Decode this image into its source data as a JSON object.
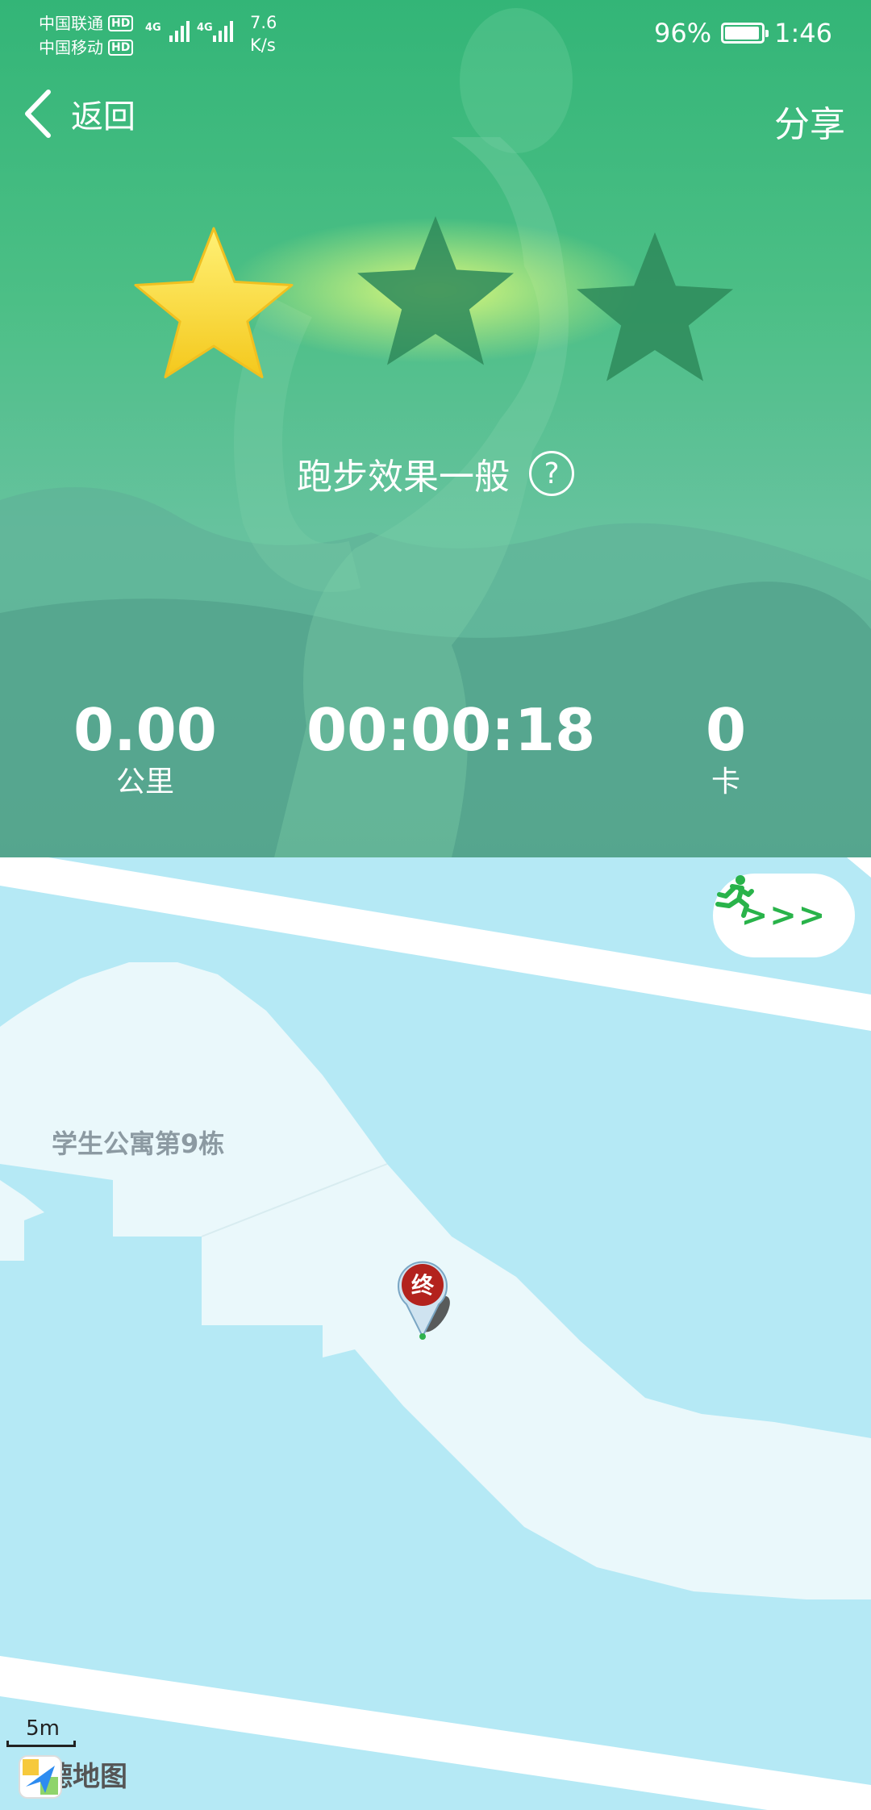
{
  "status_bar": {
    "carrier_1": "中国联通",
    "carrier_2": "中国移动",
    "hd_badge": "HD",
    "network_1": "4G",
    "network_2": "4G",
    "speed_value": "7.6",
    "speed_unit": "K/s",
    "battery": "96%",
    "battery_level": 0.96,
    "time": "1:46"
  },
  "nav": {
    "back_label": "返回",
    "share_label": "分享"
  },
  "rating": {
    "stars_total": 3,
    "stars_earned": 1,
    "text": "跑步效果一般",
    "help_glyph": "?"
  },
  "stats": {
    "distance_value": "0.00",
    "distance_unit": "公里",
    "duration_value": "00:00:18",
    "calories_value": "0",
    "calories_unit": "卡"
  },
  "map": {
    "building_label": "学生公寓第9栋",
    "end_marker_label": "终",
    "replay_arrows": ">>>",
    "scale_label": "5m",
    "provider_name": "高德地图"
  },
  "colors": {
    "hero_green": "#3fb87e",
    "star_gold": "#f9d84a",
    "star_inactive": "#2e8a5a",
    "map_water": "#b5e9f5",
    "map_land": "#eaf8fb",
    "marker_red": "#b3221d",
    "runner_green": "#29b34a"
  }
}
